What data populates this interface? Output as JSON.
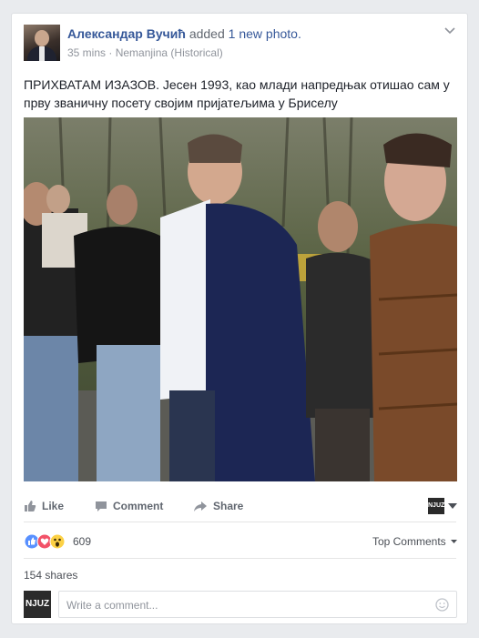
{
  "post": {
    "author": "Александар Вучић",
    "action": " added ",
    "photo_link": "1 new photo.",
    "time": "35 mins",
    "separator": " · ",
    "location": "Nemanjina (Historical)",
    "text": "ПРИХВАТАМ ИЗАЗОВ. Јесен 1993, као млади напредњак отишао сам у прву званичну посету својим пријатељима у Бриселу"
  },
  "actions": {
    "like": "Like",
    "comment": "Comment",
    "share": "Share",
    "page_logo": "NJUZ"
  },
  "reactions": {
    "types": [
      "like-icon",
      "love-icon",
      "wow-icon"
    ],
    "count": "609",
    "sort_label": "Top Comments",
    "shares": "154 shares"
  },
  "comment": {
    "avatar_text": "NJUZ",
    "placeholder": "Write a comment..."
  },
  "colors": {
    "link": "#365899",
    "like_blue": "#5890ff",
    "love_red": "#f25268",
    "wow_yellow": "#fcd145"
  }
}
